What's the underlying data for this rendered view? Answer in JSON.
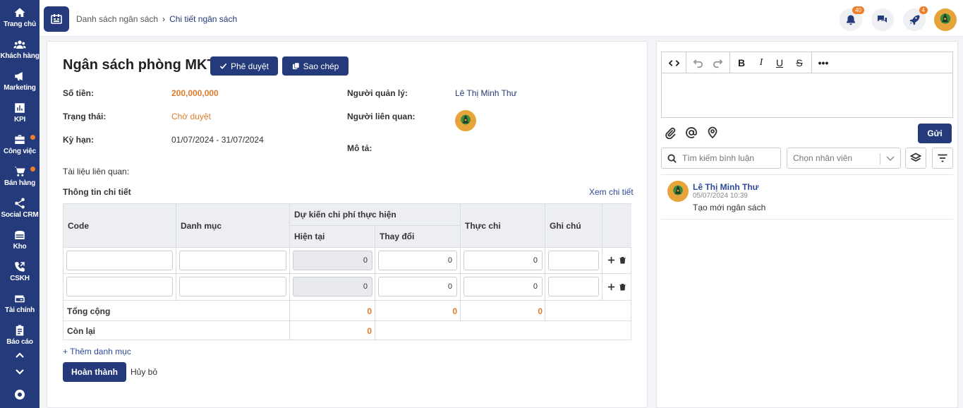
{
  "sidebar": {
    "items": [
      {
        "label": "Trang chủ",
        "icon": "home-icon"
      },
      {
        "label": "Khách hàng",
        "icon": "users-icon"
      },
      {
        "label": "Marketing",
        "icon": "megaphone-icon"
      },
      {
        "label": "KPI",
        "icon": "chart-icon"
      },
      {
        "label": "Công việc",
        "icon": "briefcase-icon"
      },
      {
        "label": "Bán hàng",
        "icon": "cart-icon"
      },
      {
        "label": "Social CRM",
        "icon": "share-icon"
      },
      {
        "label": "Kho",
        "icon": "warehouse-icon"
      },
      {
        "label": "CSKH",
        "icon": "phone-icon"
      },
      {
        "label": "Tài chính",
        "icon": "wallet-icon"
      },
      {
        "label": "Báo cáo",
        "icon": "clipboard-icon"
      }
    ]
  },
  "topbar": {
    "breadcrumb_parent": "Danh sách ngân sách",
    "breadcrumb_sep": "›",
    "breadcrumb_current": "Chi tiết ngân sách",
    "notification_count": "40",
    "rocket_count": "4"
  },
  "budget": {
    "title": "Ngân sách phòng MKT",
    "approve_label": "Phê duyệt",
    "copy_label": "Sao chép",
    "amount_label": "Số tiền:",
    "amount_value": "200,000,000",
    "status_label": "Trạng thái:",
    "status_value": "Chờ duyệt",
    "period_label": "Kỳ hạn:",
    "period_value": "01/07/2024 - 31/07/2024",
    "manager_label": "Người quản lý:",
    "manager_value": "Lê Thị Minh Thư",
    "related_label": "Người liên quan:",
    "description_label": "Mô tả:",
    "docs_label": "Tài liệu liên quan:",
    "detail_section": "Thông tin chi tiết",
    "view_detail": "Xem chi tiết"
  },
  "table": {
    "headers": {
      "code": "Code",
      "category": "Danh mục",
      "expected": "Dự kiến chi phí thực hiện",
      "current": "Hiện tại",
      "change": "Thay đổi",
      "actual": "Thực chi",
      "note": "Ghi chú"
    },
    "rows": [
      {
        "code": "",
        "category": "",
        "current": "0",
        "change": "0",
        "actual": "0",
        "note": ""
      },
      {
        "code": "",
        "category": "",
        "current": "0",
        "change": "0",
        "actual": "0",
        "note": ""
      }
    ],
    "total_label": "Tổng cộng",
    "total_current": "0",
    "total_change": "0",
    "total_actual": "0",
    "remaining_label": "Còn lại",
    "remaining_value": "0",
    "add_category": "+ Thêm danh mục"
  },
  "actions": {
    "done_label": "Hoàn thành",
    "cancel_label": "Hủy bỏ"
  },
  "comments": {
    "send_label": "Gửi",
    "search_placeholder": "Tìm kiếm bình luận",
    "employee_placeholder": "Chọn nhân viên",
    "items": [
      {
        "author": "Lê Thị Minh Thư",
        "time": "05/07/2024 10:39",
        "text": "Tạo mới ngân sách"
      }
    ]
  },
  "colors": {
    "primary": "#243a7a",
    "accent": "#e07a2a"
  }
}
